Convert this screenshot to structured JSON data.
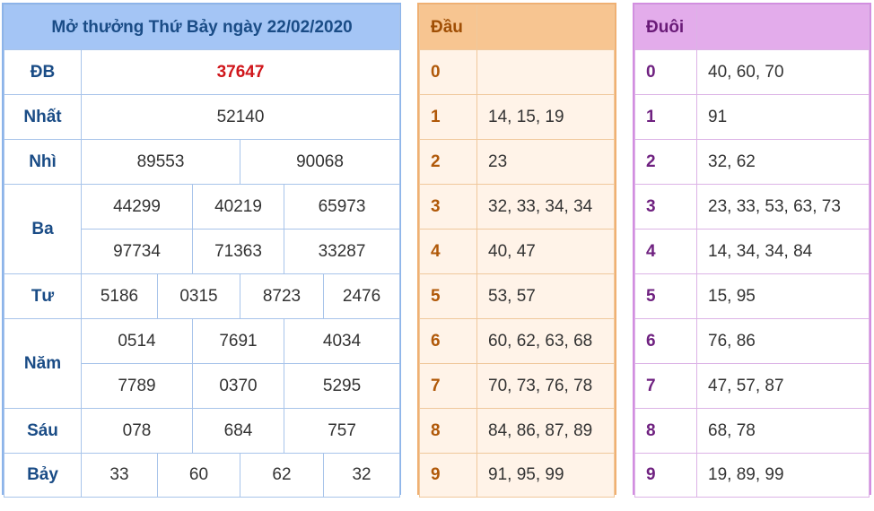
{
  "results": {
    "title": "Mở thưởng Thứ Bảy ngày 22/02/2020",
    "db": {
      "label": "ĐB",
      "value": "37647"
    },
    "nhat": {
      "label": "Nhất",
      "value": "52140"
    },
    "nhi": {
      "label": "Nhì",
      "values": [
        "89553",
        "90068"
      ]
    },
    "ba": {
      "label": "Ba",
      "values": [
        "44299",
        "40219",
        "65973",
        "97734",
        "71363",
        "33287"
      ]
    },
    "tu": {
      "label": "Tư",
      "values": [
        "5186",
        "0315",
        "8723",
        "2476"
      ]
    },
    "nam": {
      "label": "Năm",
      "values": [
        "0514",
        "7691",
        "4034",
        "7789",
        "0370",
        "5295"
      ]
    },
    "sau": {
      "label": "Sáu",
      "values": [
        "078",
        "684",
        "757"
      ]
    },
    "bay": {
      "label": "Bảy",
      "values": [
        "33",
        "60",
        "62",
        "32"
      ]
    }
  },
  "dau": {
    "header": "Đầu",
    "rows": [
      {
        "digit": "0",
        "values": ""
      },
      {
        "digit": "1",
        "values": "14, 15, 19"
      },
      {
        "digit": "2",
        "values": "23"
      },
      {
        "digit": "3",
        "values": "32, 33, 34, 34"
      },
      {
        "digit": "4",
        "values": "40, 47"
      },
      {
        "digit": "5",
        "values": "53, 57"
      },
      {
        "digit": "6",
        "values": "60, 62, 63, 68"
      },
      {
        "digit": "7",
        "values": "70, 73, 76, 78"
      },
      {
        "digit": "8",
        "values": "84, 86, 87, 89"
      },
      {
        "digit": "9",
        "values": "91, 95, 99"
      }
    ]
  },
  "duoi": {
    "header": "Đuôi",
    "rows": [
      {
        "digit": "0",
        "values": "40, 60, 70"
      },
      {
        "digit": "1",
        "values": "91"
      },
      {
        "digit": "2",
        "values": "32, 62"
      },
      {
        "digit": "3",
        "values": "23, 33, 53, 63, 73"
      },
      {
        "digit": "4",
        "values": "14, 34, 34, 84"
      },
      {
        "digit": "5",
        "values": "15, 95"
      },
      {
        "digit": "6",
        "values": "76, 86"
      },
      {
        "digit": "7",
        "values": "47, 57, 87"
      },
      {
        "digit": "8",
        "values": "68, 78"
      },
      {
        "digit": "9",
        "values": "19, 89, 99"
      }
    ]
  },
  "colors": {
    "main_border": "#8cb4ea",
    "main_header": "#a4c5f5",
    "label_text": "#1a4c86",
    "special_prize": "#d0161b",
    "dau_border": "#f0b072",
    "dau_header": "#f7c591",
    "dau_row_bg": "#fff3e8",
    "duoi_border": "#d38ee0",
    "duoi_header": "#e3aceb"
  }
}
